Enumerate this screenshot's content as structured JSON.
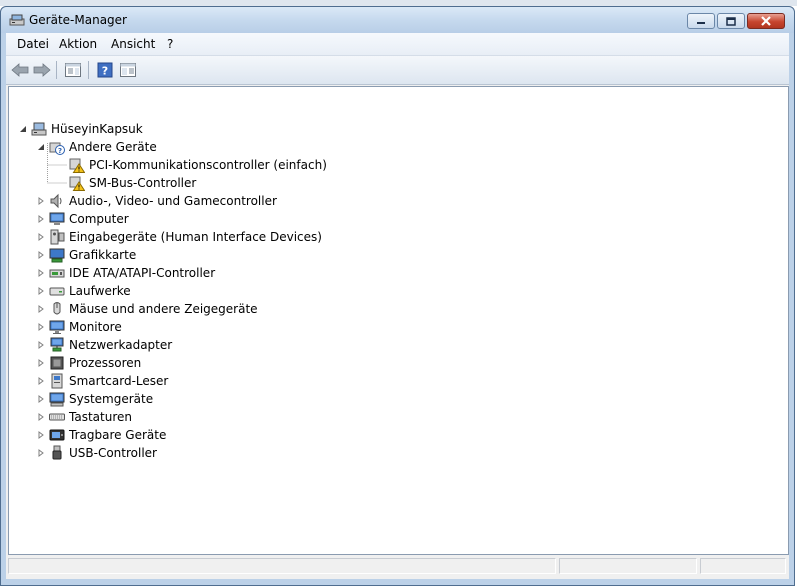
{
  "window": {
    "title": "Geräte-Manager"
  },
  "menu": {
    "items": [
      "Datei",
      "Aktion",
      "Ansicht",
      "?"
    ]
  },
  "tree": {
    "root": "HüseyinKapsuk",
    "other_devices": {
      "label": "Andere Geräte",
      "children": [
        "PCI-Kommunikationscontroller (einfach)",
        "SM-Bus-Controller"
      ]
    },
    "categories": [
      {
        "label": "Audio-, Video- und Gamecontroller",
        "icon": "speaker-icon"
      },
      {
        "label": "Computer",
        "icon": "computer-icon"
      },
      {
        "label": "Eingabegeräte (Human Interface Devices)",
        "icon": "hid-icon"
      },
      {
        "label": "Grafikkarte",
        "icon": "display-adapter-icon"
      },
      {
        "label": "IDE ATA/ATAPI-Controller",
        "icon": "ide-controller-icon"
      },
      {
        "label": "Laufwerke",
        "icon": "disk-drive-icon"
      },
      {
        "label": "Mäuse und andere Zeigegeräte",
        "icon": "mouse-icon"
      },
      {
        "label": "Monitore",
        "icon": "monitor-icon"
      },
      {
        "label": "Netzwerkadapter",
        "icon": "network-adapter-icon"
      },
      {
        "label": "Prozessoren",
        "icon": "processor-icon"
      },
      {
        "label": "Smartcard-Leser",
        "icon": "smartcard-reader-icon"
      },
      {
        "label": "Systemgeräte",
        "icon": "system-devices-icon"
      },
      {
        "label": "Tastaturen",
        "icon": "keyboard-icon"
      },
      {
        "label": "Tragbare Geräte",
        "icon": "portable-device-icon"
      },
      {
        "label": "USB-Controller",
        "icon": "usb-icon"
      }
    ]
  },
  "colors": {
    "warning": "#f4c21a",
    "accent": "#2a5fb0"
  }
}
